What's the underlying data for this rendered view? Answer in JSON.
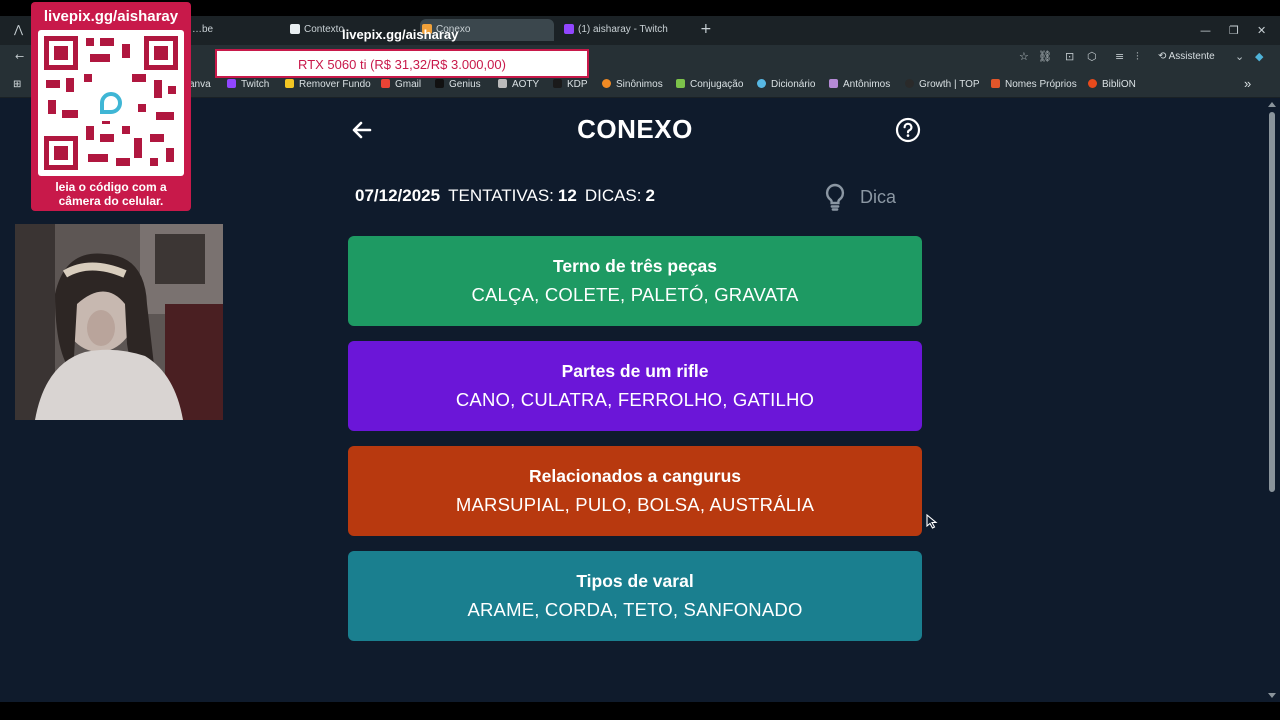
{
  "browser": {
    "tabs": [
      {
        "label": "…be",
        "active": false
      },
      {
        "label": "Contexto",
        "active": false
      },
      {
        "label": "Conexo",
        "active": true
      },
      {
        "label": "(1) aisharay - Twitch",
        "active": false
      }
    ],
    "new_tab": "+",
    "assistant_label": "Assistente",
    "bookmarks": [
      "anva",
      "Twitch",
      "Remover Fundo",
      "Gmail",
      "Genius",
      "AOTY",
      "KDP",
      "Sinônimos",
      "Conjugação",
      "Dicionário",
      "Antônimos",
      "Growth | TOP",
      "Nomes Próprios",
      "BibliON"
    ],
    "bookmark_more": "»"
  },
  "game": {
    "title": "CONEXO",
    "date": "07/12/2025",
    "attempts_label": "TENTATIVAS:",
    "attempts": "12",
    "hints_label": "DICAS:",
    "hints": "2",
    "hint_button": "Dica",
    "groups": [
      {
        "title": "Terno de três peças",
        "words": "CALÇA, COLETE, PALETÓ, GRAVATA",
        "color": "#1e9a63"
      },
      {
        "title": "Partes de um rifle",
        "words": "CANO, CULATRA, FERROLHO, GATILHO",
        "color": "#6b16d8"
      },
      {
        "title": "Relacionados a cangurus",
        "words": "MARSUPIAL, PULO, BOLSA, AUSTRÁLIA",
        "color": "#b8390f"
      },
      {
        "title": "Tipos de varal",
        "words": "ARAME, CORDA, TETO, SANFONADO",
        "color": "#1a7f8f"
      }
    ]
  },
  "stream_overlay": {
    "qr_link": "livepix.gg/aisharay",
    "qr_caption_line1": "leia o código com a",
    "qr_caption_line2": "câmera do celular.",
    "top_link": "livepix.gg/aisharay",
    "goal_text": "RTX 5060 ti (R$ 31,32/R$ 3.000,00)"
  },
  "colors": {
    "page_bg": "#0f1b2c",
    "overlay_accent": "#c8194a"
  }
}
